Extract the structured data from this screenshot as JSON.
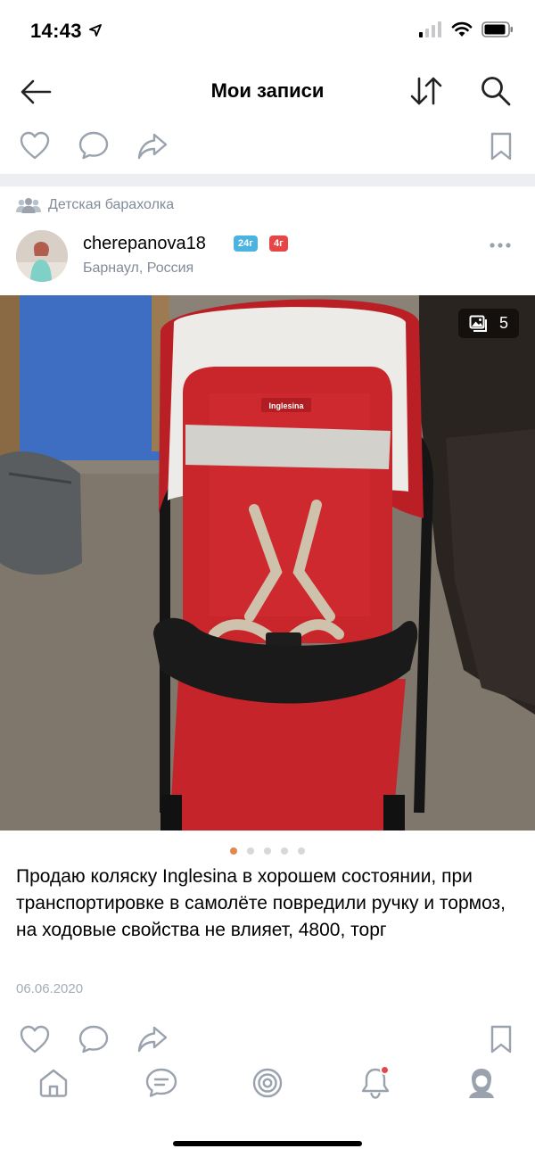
{
  "status_bar": {
    "time": "14:43",
    "signal_icon": "cellular-signal-icon",
    "wifi_icon": "wifi-icon",
    "battery_icon": "battery-icon"
  },
  "nav": {
    "title": "Мои записи",
    "back_icon": "back-arrow-icon",
    "sort_icon": "sort-icon",
    "search_icon": "search-icon"
  },
  "post": {
    "group": "Детская барахолка",
    "author": "cherepanova18",
    "badges": [
      "24г",
      "4г"
    ],
    "location": "Барнаул, Россия",
    "photo_count": "5",
    "photo_index": 1,
    "photo_total": 5,
    "text": "Продаю коляску Inglesina в хорошем состоянии, при транспортировке в самолёте повредили ручку и тормоз, на ходовые свойства не влияет, 4800, торг",
    "date": "06.06.2020",
    "photo_brand_label": "Inglesina"
  },
  "actions": {
    "like_icon": "heart-icon",
    "comment_icon": "comment-icon",
    "share_icon": "share-icon",
    "bookmark_icon": "bookmark-icon"
  },
  "tab_bar": {
    "items": [
      "home-icon",
      "messages-icon",
      "discover-icon",
      "notifications-icon",
      "profile-icon"
    ],
    "active": "notifications-icon"
  },
  "colors": {
    "icon": "#99a2ad",
    "meta": "#818c99",
    "separator": "#eceef1",
    "badge_age": "#4bb3e0",
    "badge_red": "#e64646",
    "active_dot": "#e0894a",
    "stroller_red": "#c9262b"
  }
}
